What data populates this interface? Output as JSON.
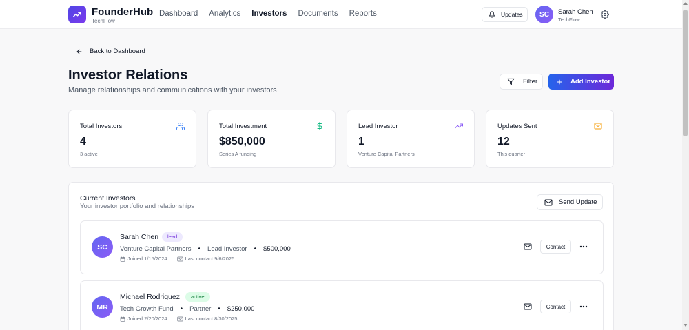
{
  "header": {
    "brand": "FounderHub",
    "company": "TechFlow",
    "nav": [
      "Dashboard",
      "Analytics",
      "Investors",
      "Documents",
      "Reports"
    ],
    "active_nav": "Investors",
    "updates_label": "Updates",
    "user_initials": "SC",
    "user_name": "Sarah Chen",
    "user_company": "TechFlow",
    "icons": {
      "logo": "trending-up-icon",
      "updates": "bell-icon",
      "settings": "gear-icon"
    }
  },
  "page": {
    "back_label": "Back to Dashboard",
    "title": "Investor Relations",
    "subtitle": "Manage relationships and communications with your investors",
    "filter_label": "Filter",
    "add_label": "Add Investor"
  },
  "stats": [
    {
      "label": "Total Investors",
      "value": "4",
      "sub": "3 active",
      "icon": "users-icon",
      "color": "#3b82f6"
    },
    {
      "label": "Total Investment",
      "value": "$850,000",
      "sub": "Series A funding",
      "icon": "dollar-icon",
      "color": "#10b981"
    },
    {
      "label": "Lead Investor",
      "value": "1",
      "sub": "Venture Capital Partners",
      "icon": "trending-up-icon",
      "color": "#8b5cf6"
    },
    {
      "label": "Updates Sent",
      "value": "12",
      "sub": "This quarter",
      "icon": "mail-icon",
      "color": "#f59e0b"
    }
  ],
  "panel": {
    "title": "Current Investors",
    "subtitle": "Your investor portfolio and relationships",
    "send_label": "Send Update"
  },
  "investors": [
    {
      "initials": "SC",
      "name": "Sarah Chen",
      "badge": "lead",
      "firm": "Venture Capital Partners",
      "role": "Lead Investor",
      "amount": "$500,000",
      "joined": "Joined 1/15/2024",
      "last_contact": "Last contact 9/6/2025",
      "contact_label": "Contact"
    },
    {
      "initials": "MR",
      "name": "Michael Rodriguez",
      "badge": "active",
      "firm": "Tech Growth Fund",
      "role": "Partner",
      "amount": "$250,000",
      "joined": "Joined 2/20/2024",
      "last_contact": "Last contact 8/30/2025",
      "contact_label": "Contact"
    }
  ]
}
